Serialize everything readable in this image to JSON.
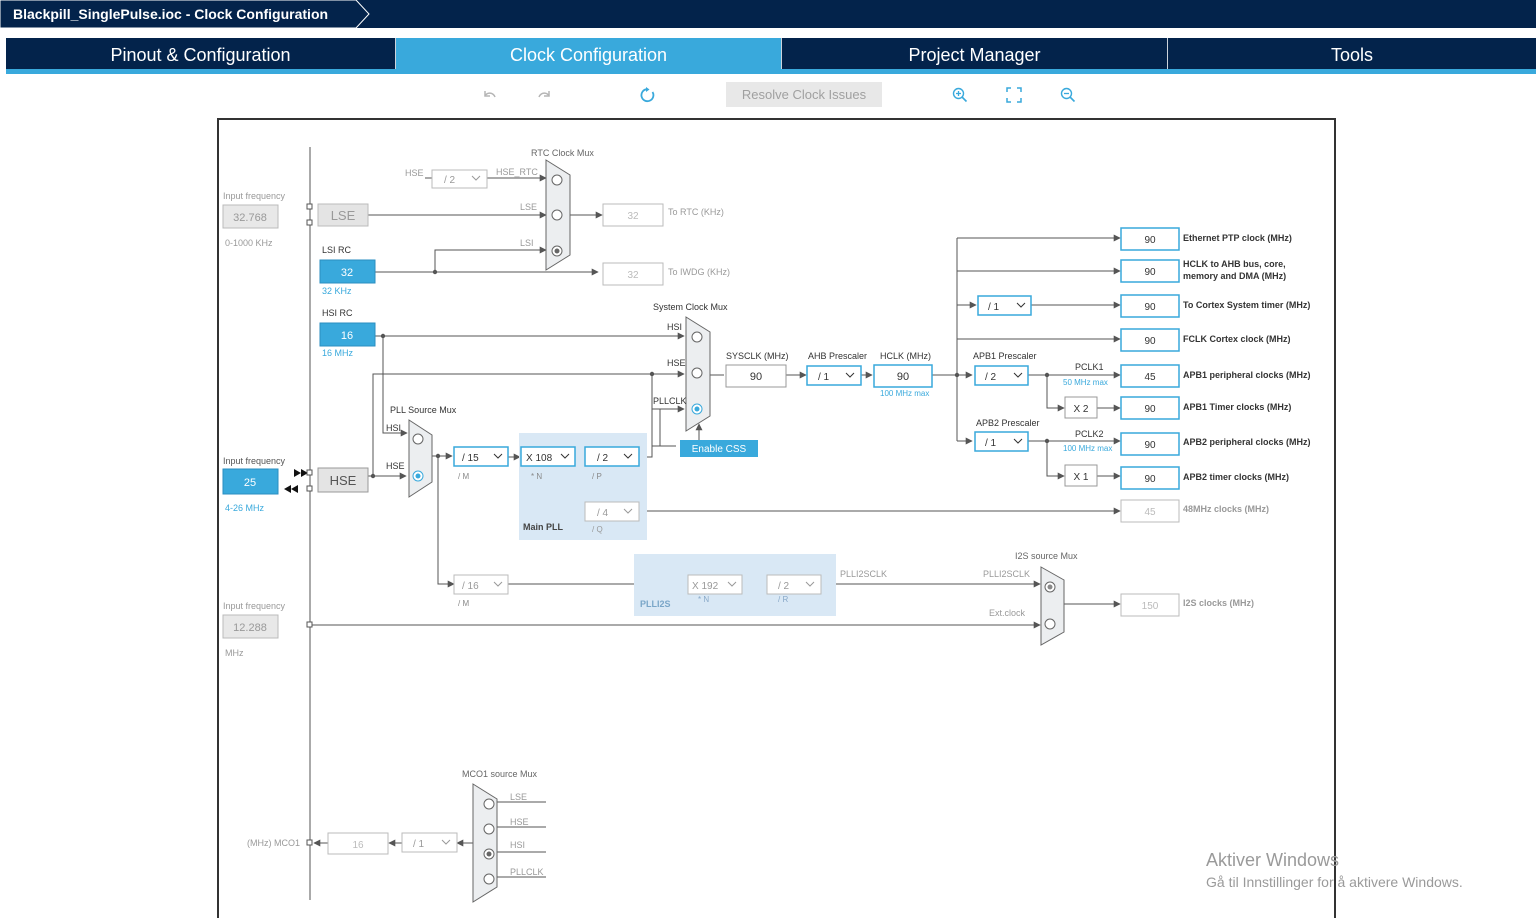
{
  "window": {
    "title": "Blackpill_SinglePulse.ioc - Clock Configuration"
  },
  "tabs": [
    {
      "label": "Pinout & Configuration"
    },
    {
      "label": "Clock Configuration"
    },
    {
      "label": "Project Manager"
    },
    {
      "label": "Tools"
    }
  ],
  "toolbar": {
    "resolve_label": "Resolve Clock Issues",
    "icons": [
      "undo-icon",
      "redo-icon",
      "refresh-icon",
      "zoom-in-icon",
      "fit-screen-icon",
      "zoom-out-icon"
    ]
  },
  "colors": {
    "accent": "#39a9dc",
    "nav": "#03234b",
    "wire": "#555555",
    "disabled": "#a8a8a8"
  },
  "clock": {
    "lse": {
      "freq_label": "Input frequency",
      "value": "32.768",
      "range": "0-1000 KHz",
      "block": "LSE"
    },
    "lsi": {
      "title": "LSI RC",
      "value": "32",
      "unit": "32 KHz"
    },
    "hsi": {
      "title": "HSI RC",
      "value": "16",
      "unit": "16 MHz"
    },
    "hse": {
      "freq_label": "Input frequency",
      "value": "25",
      "range": "4-26 MHz",
      "block": "HSE"
    },
    "i2s_in": {
      "freq_label": "Input frequency",
      "value": "12.288",
      "unit": "MHz"
    },
    "rtc": {
      "mux_title": "RTC Clock Mux",
      "hse_label": "HSE",
      "div": "/ 2",
      "hse_rtc": "HSE_RTC",
      "lse": "LSE",
      "lsi": "LSI",
      "rtc_value": "32",
      "rtc_label": "To RTC (KHz)",
      "iwdg_value": "32",
      "iwdg_label": "To IWDG (KHz)"
    },
    "pll_mux": {
      "title": "PLL Source Mux",
      "hsi": "HSI",
      "hse": "HSE"
    },
    "main_pll": {
      "m": "/ 15",
      "m_label": "/ M",
      "n": "X 108",
      "n_label": "* N",
      "p": "/ 2",
      "p_label": "/ P",
      "q": "/ 4",
      "q_label": "/ Q",
      "title": "Main PLL"
    },
    "sys_mux": {
      "title": "System Clock Mux",
      "hsi": "HSI",
      "hse": "HSE",
      "pllclk": "PLLCLK",
      "css": "Enable CSS"
    },
    "sysclk": {
      "label": "SYSCLK (MHz)",
      "value": "90"
    },
    "ahb": {
      "label": "AHB Prescaler",
      "value": "/ 1"
    },
    "hclk": {
      "label": "HCLK (MHz)",
      "value": "90",
      "max": "100 MHz max"
    },
    "cortex_div": "/ 1",
    "apb1": {
      "label": "APB1 Prescaler",
      "value": "/ 2",
      "pclk": "PCLK1",
      "max": "50 MHz max",
      "timer_mult": "X 2"
    },
    "apb2": {
      "label": "APB2 Prescaler",
      "value": "/ 1",
      "pclk": "PCLK2",
      "max": "100 MHz max",
      "timer_mult": "X 1"
    },
    "outputs": [
      {
        "value": "90",
        "label": "Ethernet PTP clock (MHz)"
      },
      {
        "value": "90",
        "label": "HCLK to AHB bus, core,",
        "label2": "memory and DMA (MHz)"
      },
      {
        "value": "90",
        "label": "To Cortex System timer (MHz)"
      },
      {
        "value": "90",
        "label": "FCLK Cortex clock (MHz)"
      },
      {
        "value": "45",
        "label": "APB1 peripheral clocks (MHz)"
      },
      {
        "value": "90",
        "label": "APB1 Timer clocks (MHz)"
      },
      {
        "value": "90",
        "label": "APB2 peripheral clocks (MHz)"
      },
      {
        "value": "90",
        "label": "APB2 timer clocks (MHz)"
      },
      {
        "value": "45",
        "label": "48MHz clocks (MHz)"
      }
    ],
    "plli2s": {
      "m": "/ 16",
      "m_label": "/ M",
      "n": "X 192",
      "n_label": "* N",
      "r": "/ 2",
      "r_label": "/ R",
      "title": "PLLI2S",
      "out": "PLLI2SCLK"
    },
    "i2s_mux": {
      "title": "I2S source Mux",
      "plli2sclk": "PLLI2SCLK",
      "ext": "Ext.clock",
      "value": "150",
      "label": "I2S clocks (MHz)"
    },
    "mco1": {
      "title": "MCO1 source Mux",
      "lse": "LSE",
      "hse": "HSE",
      "hsi": "HSI",
      "pllclk": "PLLCLK",
      "div": "/ 1",
      "value": "16",
      "label": "(MHz) MCO1"
    }
  },
  "watermark": {
    "title": "Aktiver Windows",
    "subtitle": "Gå til Innstillinger for å aktivere Windows."
  }
}
